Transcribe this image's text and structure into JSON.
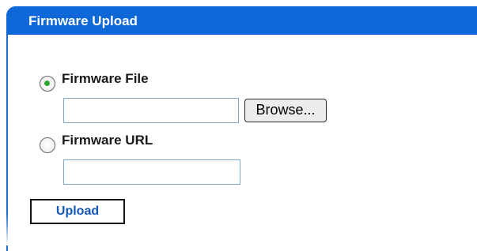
{
  "panel": {
    "title": "Firmware Upload"
  },
  "options": {
    "file": {
      "label": "Firmware File",
      "selected": true,
      "value": ""
    },
    "url": {
      "label": "Firmware URL",
      "selected": false,
      "value": ""
    }
  },
  "buttons": {
    "browse_label": "Browse...",
    "upload_label": "Upload"
  },
  "colors": {
    "header_background": "#0f68d8",
    "header_text": "#ffffff",
    "upload_text": "#1358b8",
    "radio_dot": "#2ba52b"
  }
}
